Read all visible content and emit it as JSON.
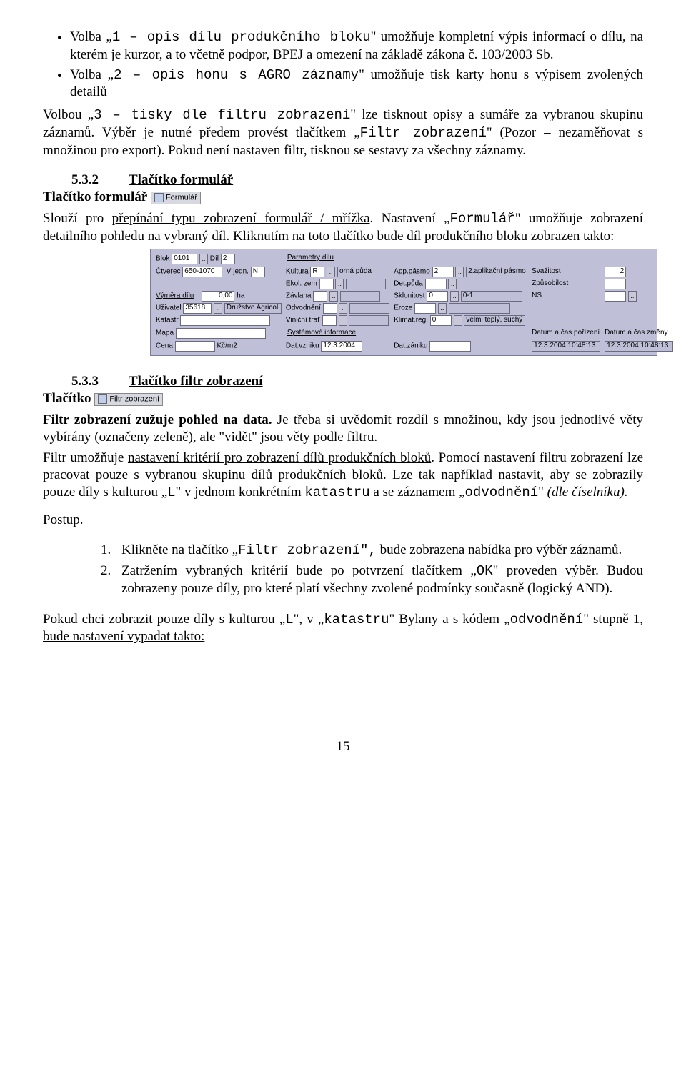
{
  "bullet1_a": "Volba „",
  "bullet1_b": "1 – opis dílu produkčního bloku",
  "bullet1_c": "\" umožňuje kompletní výpis informací o dílu, na kterém je kurzor, a to včetně podpor, BPEJ a omezení na základě zákona č. 103/2003 Sb.",
  "bullet2_a": "Volba „",
  "bullet2_b": "2 – opis honu s AGRO záznamy",
  "bullet2_c": "\" umožňuje tisk karty honu s výpisem zvolených detailů",
  "after_bullets_1": "Volbou „",
  "after_bullets_2": "3 – tisky dle filtru zobrazení",
  "after_bullets_3": "\" lze tisknout opisy a sumáře za vybranou skupinu záznamů. Výběr je nutné předem provést tlačítkem „",
  "after_bullets_4": "Filtr zobrazení",
  "after_bullets_5": "\" (Pozor – nezaměňovat s množinou pro export). Pokud není nastaven filtr, tisknou se sestavy za všechny záznamy.",
  "h532_num": "5.3.2",
  "h532_txt": "Tlačítko formulář",
  "h532_sub": "Tlačítko formulář",
  "btn1_label": "Formulář",
  "p532_1": "Slouží pro ",
  "p532_2": "přepínání typu zobrazení formulář / mřížka",
  "p532_3": ". Nastavení „",
  "p532_4": "Formulář",
  "p532_5": "\" umožňuje zobrazení detailního pohledu na vybraný díl. Kliknutím na toto tlačítko bude díl produkčního bloku zobrazen takto:",
  "form": {
    "sec1": "Parametry dílu",
    "blok_l": "Blok",
    "blok_v": "0101",
    "dd": "..",
    "dil_l": "Díl",
    "dil_v": "2",
    "ctv_l": "Čtverec",
    "ctv_v": "650-1070",
    "vj_l": "V jedn.",
    "vj_v": "N",
    "kult_l": "Kultura",
    "kult_v": "R",
    "kult_t": "orná půda",
    "app_l": "App.pásmo",
    "app_v": "2",
    "app2_l": "2.aplikační pásmo",
    "svaz_l": "Svažitost",
    "svaz_v": "2",
    "ekol_l": "Ekol. zem",
    "det_l": "Det.půda",
    "zpus_l": "Způsobilost",
    "vymd_l": "Výměra dílu",
    "vymd_v": "0,00",
    "ha": "ha",
    "zav_l": "Závlaha",
    "skl_l": "Sklonitost",
    "skl_v": "0",
    "skl_t": "0-1",
    "ns_l": "NS",
    "uziv_l": "Uživatel",
    "uziv_v": "35618",
    "uziv_t": "Družstvo Agricol",
    "odv_l": "Odvodnění",
    "ero_l": "Eroze",
    "kat_l": "Katastr",
    "vin_l": "Viniční trať",
    "klim_l": "Klimat.reg.",
    "klim_v": "0",
    "klim_t": "velmi teplý, suchý",
    "mapa_l": "Mapa",
    "sec2": "Systémové informace",
    "datpor_l": "Datum a čas pořízení",
    "datzm_l": "Datum a čas změny",
    "cena_l": "Cena",
    "cena_u": "Kč/m2",
    "datvz_l": "Dat.vzniku",
    "datvz_v": "12.3.2004",
    "datzan_l": "Dat.zániku",
    "datpor_v": "12.3.2004 10:48:13",
    "datzm_v": "12.3.2004 10:48:13"
  },
  "h533_num": "5.3.3",
  "h533_txt": "Tlačítko filtr zobrazení",
  "h533_sub": "Tlačítko",
  "btn2_label": "Filtr zobrazení",
  "p533_1a": "Filtr zobrazení zužuje pohled na data.",
  "p533_1b": " Je třeba si uvědomit rozdíl s množinou, kdy jsou jednotlivé věty vybírány (označeny zeleně), ale \"vidět\" jsou věty podle filtru.",
  "p533_2a": "Filtr umožňuje ",
  "p533_2b": "nastavení kritérií pro zobrazení dílů produkčních bloků",
  "p533_2c": ". Pomocí nastavení filtru zobrazení lze pracovat pouze s vybranou skupinu dílů produkčních bloků. Lze tak například nastavit, aby se zobrazily pouze díly s kulturou „",
  "p533_2d": "L",
  "p533_2e": "\" v jednom konkrétním ",
  "p533_2f": "katastru",
  "p533_2g": " a se záznamem „",
  "p533_2h": "odvodnění",
  "p533_2i": "\" ",
  "p533_2j": "(dle číselníku).",
  "postup": "Postup.",
  "step1a": "Klikněte na tlačítko „",
  "step1b": "Filtr zobrazení\",",
  "step1c": " bude zobrazena nabídka pro výběr záznamů.",
  "step2a": "Zatržením vybraných kritérií bude po potvrzení tlačítkem „",
  "step2b": "OK",
  "step2c": "\" proveden výběr. Budou zobrazeny pouze díly, pro které platí všechny zvolené podmínky současně (logický AND).",
  "last_1": "Pokud chci zobrazit pouze díly s kulturou „",
  "last_2": "L",
  "last_3": "\", v „",
  "last_4": "katastru",
  "last_5": "\" Bylany a s kódem „",
  "last_6": "odvodnění",
  "last_7": "\" stupně 1, ",
  "last_8": "bude nastavení vypadat takto:",
  "page_num": "15"
}
